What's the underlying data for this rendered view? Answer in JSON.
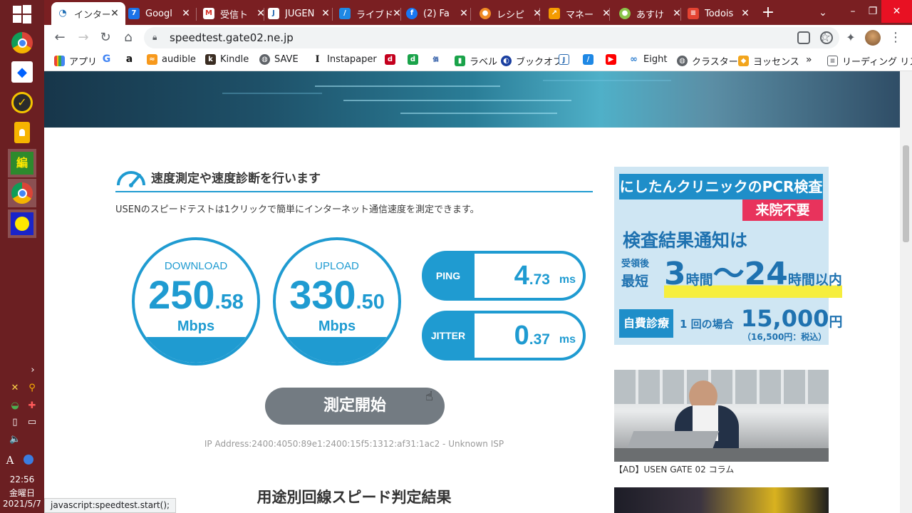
{
  "taskbar": {
    "clock_time": "22:56",
    "clock_day": "金曜日",
    "clock_date": "2021/5/7",
    "ime": "A",
    "app_icons": [
      "chrome-icon",
      "dropbox-icon",
      "norton-icon",
      "keep-icon",
      "app-icon",
      "chrome-icon",
      "app-icon"
    ]
  },
  "browser": {
    "tabs": [
      {
        "label": "インター",
        "active": true
      },
      {
        "label": "Googl",
        "active": false
      },
      {
        "label": "受信ト",
        "active": false
      },
      {
        "label": "JUGEN",
        "active": false
      },
      {
        "label": "ライブド",
        "active": false
      },
      {
        "label": "(2) Fa",
        "active": false
      },
      {
        "label": "レシピ",
        "active": false
      },
      {
        "label": "マネー",
        "active": false
      },
      {
        "label": "あすけ",
        "active": false
      },
      {
        "label": "Todois",
        "active": false
      }
    ],
    "url": "speedtest.gate02.ne.jp",
    "bookmarks": [
      {
        "label": "アプリ"
      },
      {
        "label": ""
      },
      {
        "label": ""
      },
      {
        "label": "audible"
      },
      {
        "label": "Kindle"
      },
      {
        "label": "SAVE"
      },
      {
        "label": "Instapaper"
      },
      {
        "label": ""
      },
      {
        "label": ""
      },
      {
        "label": ""
      },
      {
        "label": "ラベル"
      },
      {
        "label": "ブックオフ"
      },
      {
        "label": ""
      },
      {
        "label": ""
      },
      {
        "label": ""
      },
      {
        "label": "Eight"
      },
      {
        "label": "クラスター"
      },
      {
        "label": "ヨッセンス"
      }
    ],
    "bookmarks_overflow": "»",
    "reading_list": "リーディング リスト",
    "status_tip": "javascript:speedtest.start();"
  },
  "speedtest": {
    "section_title": "速度測定や速度診断を行います",
    "intro": "USENのスピードテストは1クリックで簡単にインターネット通信速度を測定できます。",
    "download": {
      "label": "DOWNLOAD",
      "int": "250",
      "dec": ".58",
      "unit": "Mbps"
    },
    "upload": {
      "label": "UPLOAD",
      "int": "330",
      "dec": ".50",
      "unit": "Mbps"
    },
    "ping": {
      "label": "PING",
      "int": "4",
      "dec": ".73",
      "unit": "ms"
    },
    "jitter": {
      "label": "JITTER",
      "int": "0",
      "dec": ".37",
      "unit": "ms"
    },
    "start_button": "測定開始",
    "ip_line": "IP Address:2400:4050:89e1:2400:15f5:1312:af31:1ac2 - Unknown ISP",
    "results_heading": "用途別回線スピード判定結果"
  },
  "ads": {
    "ad1": {
      "headline": "にしたんクリニックのPCR検査",
      "badge": "来院不要",
      "line1": "検査結果通知は",
      "pre_top": "受領後",
      "pre_bottom": "最短",
      "hours": "3時間～24時間以内",
      "tag": "自費診療",
      "once": "1 回の場合",
      "price": "15,000円",
      "tax": "（16,500円：税込）"
    },
    "ad2_caption": "【AD】USEN GATE 02 コラム"
  },
  "colors": {
    "accent": "#1f9bd1",
    "start_button": "#737b82",
    "tabstrip": "#7a1f22",
    "taskbar": "#6b1f22"
  }
}
